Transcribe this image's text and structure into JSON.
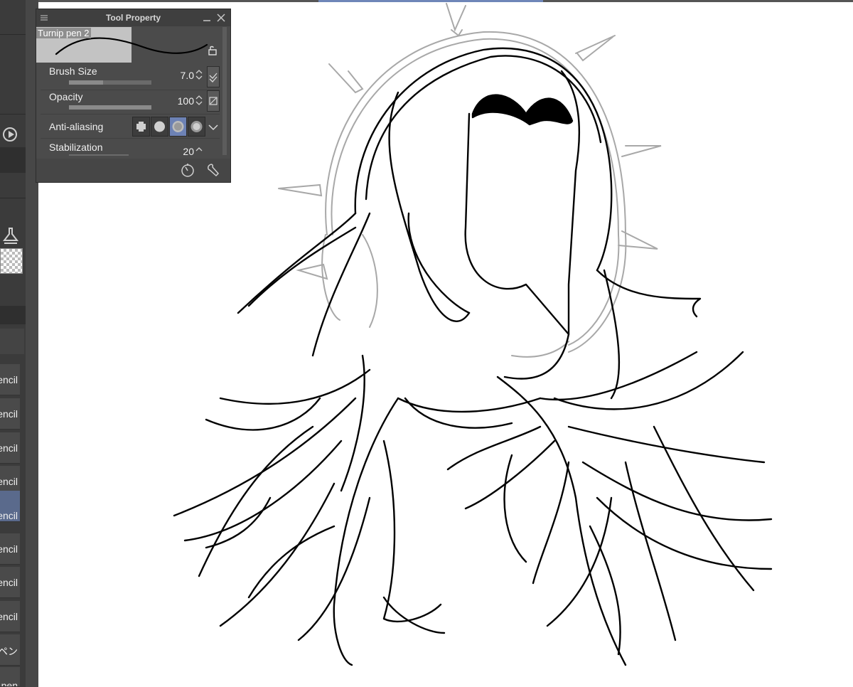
{
  "panel": {
    "title": "Tool Property",
    "brush_preview_name": "Turnip pen 2",
    "properties": [
      {
        "label": "Brush Size",
        "value": "7.0"
      },
      {
        "label": "Opacity",
        "value": "100"
      },
      {
        "label": "Anti-aliasing",
        "value": ""
      },
      {
        "label": "Stabilization",
        "value": "20"
      }
    ]
  },
  "tool_list": {
    "items": [
      {
        "label": "encil"
      },
      {
        "label": "encil"
      },
      {
        "label": "encil"
      },
      {
        "label": "encil"
      },
      {
        "label": "encil"
      },
      {
        "label": "encil"
      },
      {
        "label": "encil"
      },
      {
        "label": "encil"
      },
      {
        "label": "ペン"
      },
      {
        "label": "pen"
      }
    ],
    "selected_index": 4
  },
  "colors": {
    "chrome_dark": "#3b3b3b",
    "panel_bg": "#4b4b4b",
    "accent_selected": "#6d82b5",
    "line_art": "#000000",
    "sketch_line": "#9a9a9a"
  },
  "icons": [
    "menu-icon",
    "minimize-icon",
    "close-icon",
    "lock-icon",
    "play-icon",
    "clear-layer-icon",
    "transparent-swatch",
    "settings-dial-icon",
    "wrench-icon",
    "chevron-down-icon"
  ]
}
